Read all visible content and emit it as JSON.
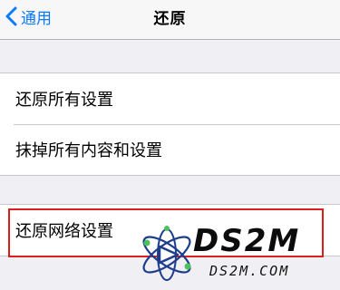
{
  "nav": {
    "back_label": "通用",
    "title": "还原",
    "back_icon": "chevron-left-icon",
    "accent_color": "#0a7aff"
  },
  "group1": {
    "items": [
      {
        "label": "还原所有设置"
      },
      {
        "label": "抹掉所有内容和设置"
      }
    ]
  },
  "group2": {
    "items": [
      {
        "label": "还原网络设置"
      }
    ]
  },
  "highlight_color": "#d9201f",
  "watermark": {
    "title": "DS2M",
    "subtitle": "DS2M.COM",
    "logo_icon": "atom-logo-icon"
  }
}
